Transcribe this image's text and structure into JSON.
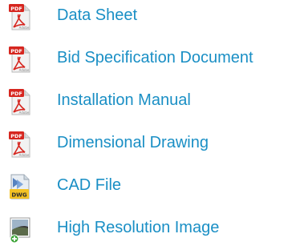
{
  "colors": {
    "link": "#1a8fc5"
  },
  "documents": [
    {
      "label": "Data Sheet",
      "icon": "pdf-icon",
      "icon_text": "PDF"
    },
    {
      "label": "Bid Specification Document",
      "icon": "pdf-icon",
      "icon_text": "PDF"
    },
    {
      "label": "Installation Manual",
      "icon": "pdf-icon",
      "icon_text": "PDF"
    },
    {
      "label": "Dimensional Drawing",
      "icon": "pdf-icon",
      "icon_text": "PDF"
    },
    {
      "label": "CAD File",
      "icon": "dwg-icon",
      "icon_text": "DWG"
    },
    {
      "label": "High Resolution Image",
      "icon": "image-download-icon"
    }
  ]
}
